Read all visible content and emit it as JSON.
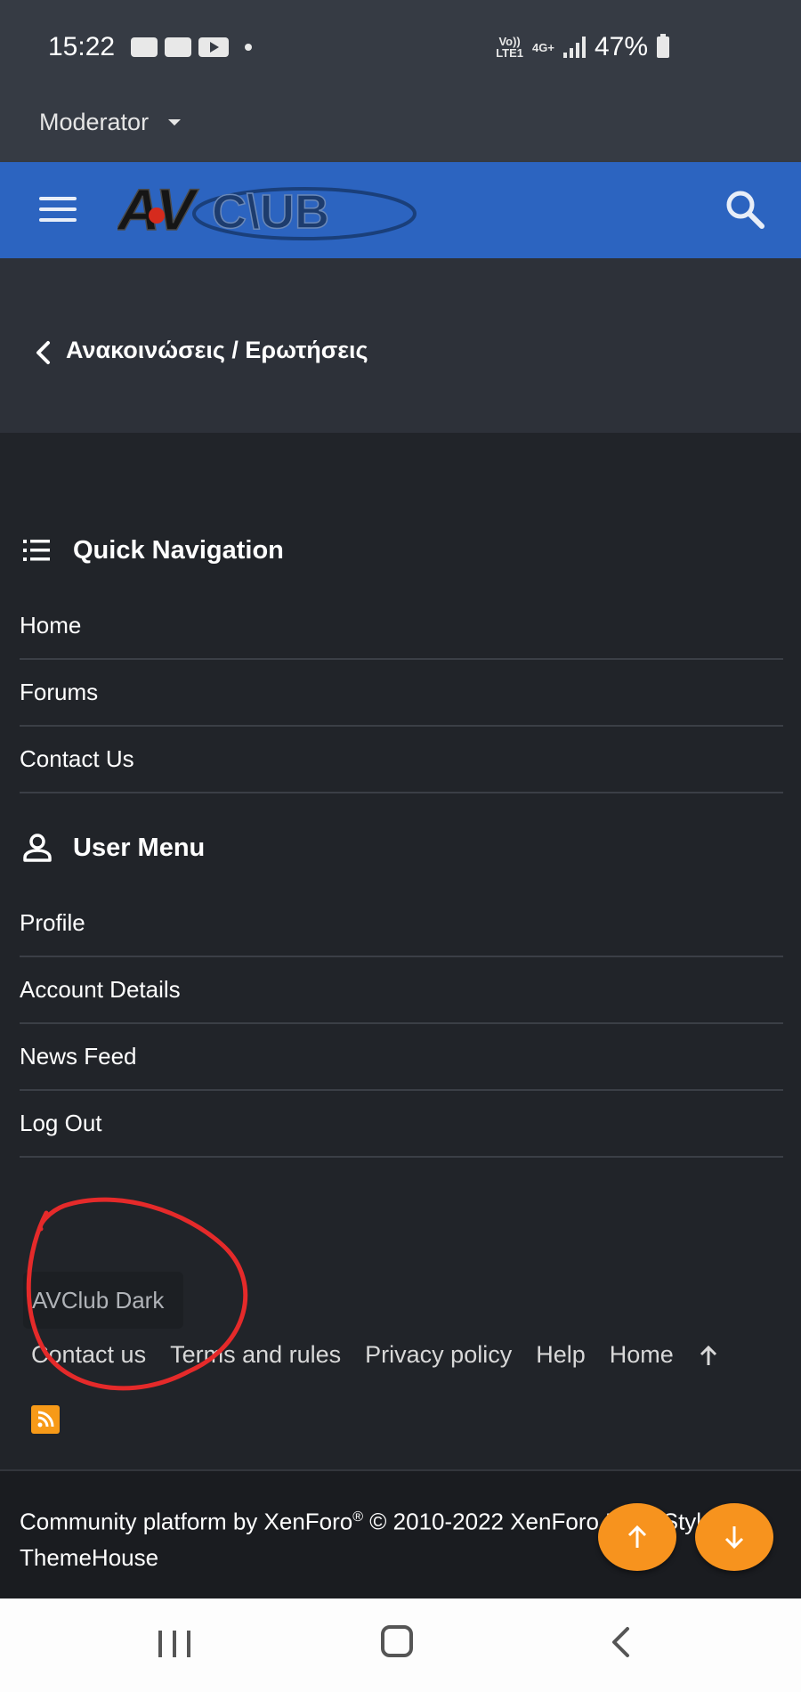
{
  "status_bar": {
    "time": "15:22",
    "network_top": "Vo))",
    "network_bottom": "LTE1",
    "network_type": "4G+",
    "battery": "47%"
  },
  "role_menu": {
    "label": "Moderator"
  },
  "header": {
    "logo_text": "AVCLUB",
    "colors": {
      "bar": "#2c64c0",
      "accent": "#f7931e"
    }
  },
  "breadcrumb": {
    "label": "Ανακοινώσεις / Ερωτήσεις"
  },
  "quick_nav": {
    "title": "Quick Navigation",
    "items": [
      "Home",
      "Forums",
      "Contact Us"
    ]
  },
  "user_menu": {
    "title": "User Menu",
    "items": [
      "Profile",
      "Account Details",
      "News Feed",
      "Log Out"
    ]
  },
  "style_chooser": {
    "label": "AVClub Dark"
  },
  "footer": {
    "links": [
      "Contact us",
      "Terms and rules",
      "Privacy policy",
      "Help",
      "Home"
    ]
  },
  "copyright": {
    "prefix": "Community platform by XenForo",
    "reg": "®",
    "suffix": " © 2010-2022 XenForo Ltd. | Style by ThemeHouse"
  }
}
